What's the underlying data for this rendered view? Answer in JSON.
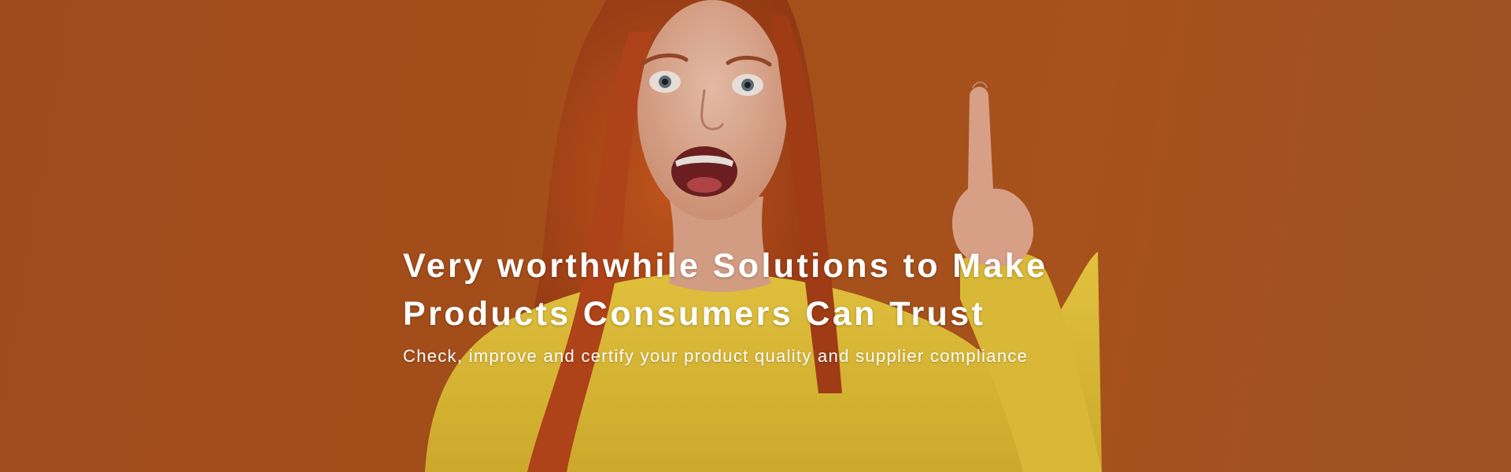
{
  "hero": {
    "headline_line1": "Very worthwhile Solutions to Make",
    "headline_line2": "Products Consumers Can Trust",
    "subheadline": "Check, improve and certify your product quality and supplier compliance"
  },
  "colors": {
    "background": "#ad531d",
    "sweater": "#e8c53a",
    "hair": "#b8461c",
    "skin": "#e9b9a0",
    "text": "#ffffff"
  },
  "icons": {
    "hero_image": "woman-pointing-up-photo"
  }
}
